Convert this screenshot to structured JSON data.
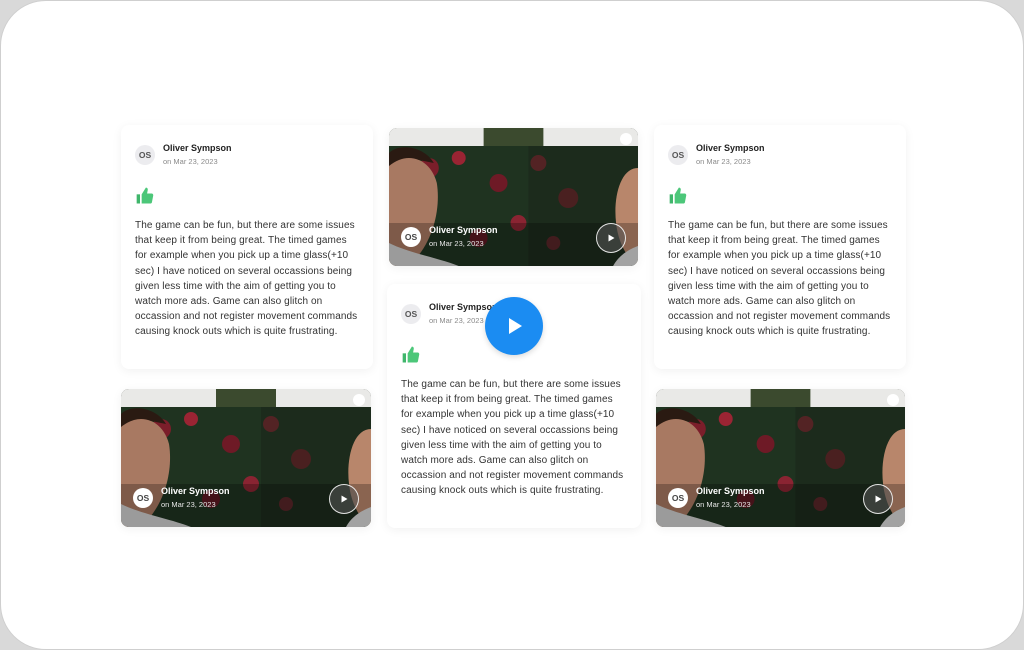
{
  "review": {
    "author_initials": "OS",
    "author_name": "Oliver Sympson",
    "date": "on Mar 23, 2023",
    "text": "The game can be fun, but there are some issues that keep it from being great. The timed games for example when you pick up a time glass(+10 sec) I have noticed on several occassions being given less time with the aim of getting you to watch more ads. Game can also glitch on occassion and not register movement commands causing knock outs which is quite frustrating."
  },
  "icons": {
    "thumb": "thumbs-up-icon",
    "play": "play-icon",
    "big_play": "play-icon"
  },
  "colors": {
    "thumb_green": "#3fb66b",
    "play_blue": "#1b8cf2"
  }
}
